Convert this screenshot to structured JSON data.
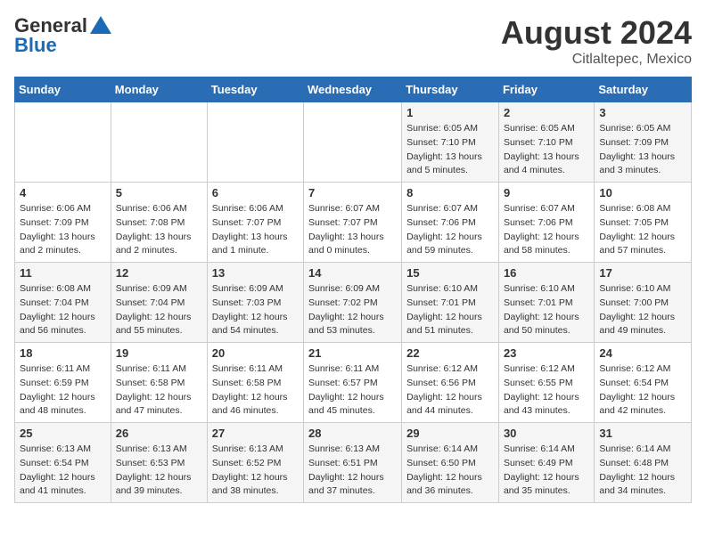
{
  "header": {
    "logo_general": "General",
    "logo_blue": "Blue",
    "month_year": "August 2024",
    "location": "Citlaltepec, Mexico"
  },
  "weekdays": [
    "Sunday",
    "Monday",
    "Tuesday",
    "Wednesday",
    "Thursday",
    "Friday",
    "Saturday"
  ],
  "weeks": [
    [
      {
        "day": "",
        "info": ""
      },
      {
        "day": "",
        "info": ""
      },
      {
        "day": "",
        "info": ""
      },
      {
        "day": "",
        "info": ""
      },
      {
        "day": "1",
        "info": "Sunrise: 6:05 AM\nSunset: 7:10 PM\nDaylight: 13 hours\nand 5 minutes."
      },
      {
        "day": "2",
        "info": "Sunrise: 6:05 AM\nSunset: 7:10 PM\nDaylight: 13 hours\nand 4 minutes."
      },
      {
        "day": "3",
        "info": "Sunrise: 6:05 AM\nSunset: 7:09 PM\nDaylight: 13 hours\nand 3 minutes."
      }
    ],
    [
      {
        "day": "4",
        "info": "Sunrise: 6:06 AM\nSunset: 7:09 PM\nDaylight: 13 hours\nand 2 minutes."
      },
      {
        "day": "5",
        "info": "Sunrise: 6:06 AM\nSunset: 7:08 PM\nDaylight: 13 hours\nand 2 minutes."
      },
      {
        "day": "6",
        "info": "Sunrise: 6:06 AM\nSunset: 7:07 PM\nDaylight: 13 hours\nand 1 minute."
      },
      {
        "day": "7",
        "info": "Sunrise: 6:07 AM\nSunset: 7:07 PM\nDaylight: 13 hours\nand 0 minutes."
      },
      {
        "day": "8",
        "info": "Sunrise: 6:07 AM\nSunset: 7:06 PM\nDaylight: 12 hours\nand 59 minutes."
      },
      {
        "day": "9",
        "info": "Sunrise: 6:07 AM\nSunset: 7:06 PM\nDaylight: 12 hours\nand 58 minutes."
      },
      {
        "day": "10",
        "info": "Sunrise: 6:08 AM\nSunset: 7:05 PM\nDaylight: 12 hours\nand 57 minutes."
      }
    ],
    [
      {
        "day": "11",
        "info": "Sunrise: 6:08 AM\nSunset: 7:04 PM\nDaylight: 12 hours\nand 56 minutes."
      },
      {
        "day": "12",
        "info": "Sunrise: 6:09 AM\nSunset: 7:04 PM\nDaylight: 12 hours\nand 55 minutes."
      },
      {
        "day": "13",
        "info": "Sunrise: 6:09 AM\nSunset: 7:03 PM\nDaylight: 12 hours\nand 54 minutes."
      },
      {
        "day": "14",
        "info": "Sunrise: 6:09 AM\nSunset: 7:02 PM\nDaylight: 12 hours\nand 53 minutes."
      },
      {
        "day": "15",
        "info": "Sunrise: 6:10 AM\nSunset: 7:01 PM\nDaylight: 12 hours\nand 51 minutes."
      },
      {
        "day": "16",
        "info": "Sunrise: 6:10 AM\nSunset: 7:01 PM\nDaylight: 12 hours\nand 50 minutes."
      },
      {
        "day": "17",
        "info": "Sunrise: 6:10 AM\nSunset: 7:00 PM\nDaylight: 12 hours\nand 49 minutes."
      }
    ],
    [
      {
        "day": "18",
        "info": "Sunrise: 6:11 AM\nSunset: 6:59 PM\nDaylight: 12 hours\nand 48 minutes."
      },
      {
        "day": "19",
        "info": "Sunrise: 6:11 AM\nSunset: 6:58 PM\nDaylight: 12 hours\nand 47 minutes."
      },
      {
        "day": "20",
        "info": "Sunrise: 6:11 AM\nSunset: 6:58 PM\nDaylight: 12 hours\nand 46 minutes."
      },
      {
        "day": "21",
        "info": "Sunrise: 6:11 AM\nSunset: 6:57 PM\nDaylight: 12 hours\nand 45 minutes."
      },
      {
        "day": "22",
        "info": "Sunrise: 6:12 AM\nSunset: 6:56 PM\nDaylight: 12 hours\nand 44 minutes."
      },
      {
        "day": "23",
        "info": "Sunrise: 6:12 AM\nSunset: 6:55 PM\nDaylight: 12 hours\nand 43 minutes."
      },
      {
        "day": "24",
        "info": "Sunrise: 6:12 AM\nSunset: 6:54 PM\nDaylight: 12 hours\nand 42 minutes."
      }
    ],
    [
      {
        "day": "25",
        "info": "Sunrise: 6:13 AM\nSunset: 6:54 PM\nDaylight: 12 hours\nand 41 minutes."
      },
      {
        "day": "26",
        "info": "Sunrise: 6:13 AM\nSunset: 6:53 PM\nDaylight: 12 hours\nand 39 minutes."
      },
      {
        "day": "27",
        "info": "Sunrise: 6:13 AM\nSunset: 6:52 PM\nDaylight: 12 hours\nand 38 minutes."
      },
      {
        "day": "28",
        "info": "Sunrise: 6:13 AM\nSunset: 6:51 PM\nDaylight: 12 hours\nand 37 minutes."
      },
      {
        "day": "29",
        "info": "Sunrise: 6:14 AM\nSunset: 6:50 PM\nDaylight: 12 hours\nand 36 minutes."
      },
      {
        "day": "30",
        "info": "Sunrise: 6:14 AM\nSunset: 6:49 PM\nDaylight: 12 hours\nand 35 minutes."
      },
      {
        "day": "31",
        "info": "Sunrise: 6:14 AM\nSunset: 6:48 PM\nDaylight: 12 hours\nand 34 minutes."
      }
    ]
  ]
}
